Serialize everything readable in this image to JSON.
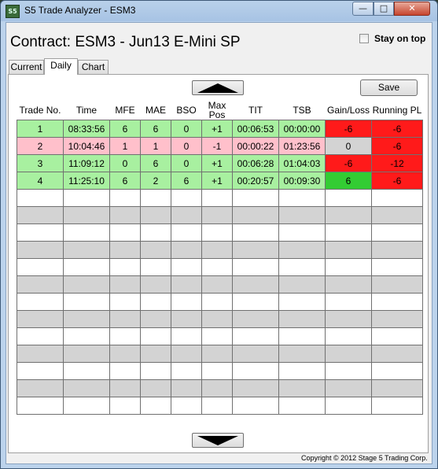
{
  "window": {
    "title": "S5 Trade Analyzer - ESM3",
    "icon_text": "S5",
    "min_glyph": "—",
    "max_glyph": "□",
    "close_glyph": "✕"
  },
  "header": {
    "contract_title": "Contract: ESM3 - Jun13 E-Mini SP",
    "stay_on_top_label": "Stay on top",
    "stay_on_top_checked": false
  },
  "tabs": [
    {
      "label": "Current",
      "active": false
    },
    {
      "label": "Daily",
      "active": true
    },
    {
      "label": "Chart",
      "active": false
    }
  ],
  "toolbar": {
    "save_label": "Save",
    "scroll_up_icon": "triangle-up-icon",
    "scroll_down_icon": "triangle-down-icon"
  },
  "table": {
    "columns": [
      "Trade No.",
      "Time",
      "MFE",
      "MAE",
      "BSO",
      "Max Pos",
      "TIT",
      "TSB",
      "Gain/Loss",
      "Running PL"
    ],
    "rows": [
      {
        "cells": [
          "1",
          "08:33:56",
          "6",
          "6",
          "0",
          "+1",
          "00:06:53",
          "00:00:00",
          "-6",
          "-6"
        ],
        "row_color": "#a8f0a0",
        "gain_color": "#ff1a1a",
        "pl_color": "#ff1a1a"
      },
      {
        "cells": [
          "2",
          "10:04:46",
          "1",
          "1",
          "0",
          "-1",
          "00:00:22",
          "01:23:56",
          "0",
          "-6"
        ],
        "row_color": "#ffc0cb",
        "gain_color": "#d3d3d3",
        "pl_color": "#ff1a1a"
      },
      {
        "cells": [
          "3",
          "11:09:12",
          "0",
          "6",
          "0",
          "+1",
          "00:06:28",
          "01:04:03",
          "-6",
          "-12"
        ],
        "row_color": "#a8f0a0",
        "gain_color": "#ff1a1a",
        "pl_color": "#ff1a1a"
      },
      {
        "cells": [
          "4",
          "11:25:10",
          "6",
          "2",
          "6",
          "+1",
          "00:20:57",
          "00:09:30",
          "6",
          "-6"
        ],
        "row_color": "#a8f0a0",
        "gain_color": "#33cc33",
        "pl_color": "#ff1a1a"
      }
    ],
    "empty_row_count": 13
  },
  "footer": {
    "copyright": "Copyright © 2012 Stage 5 Trading Corp."
  }
}
